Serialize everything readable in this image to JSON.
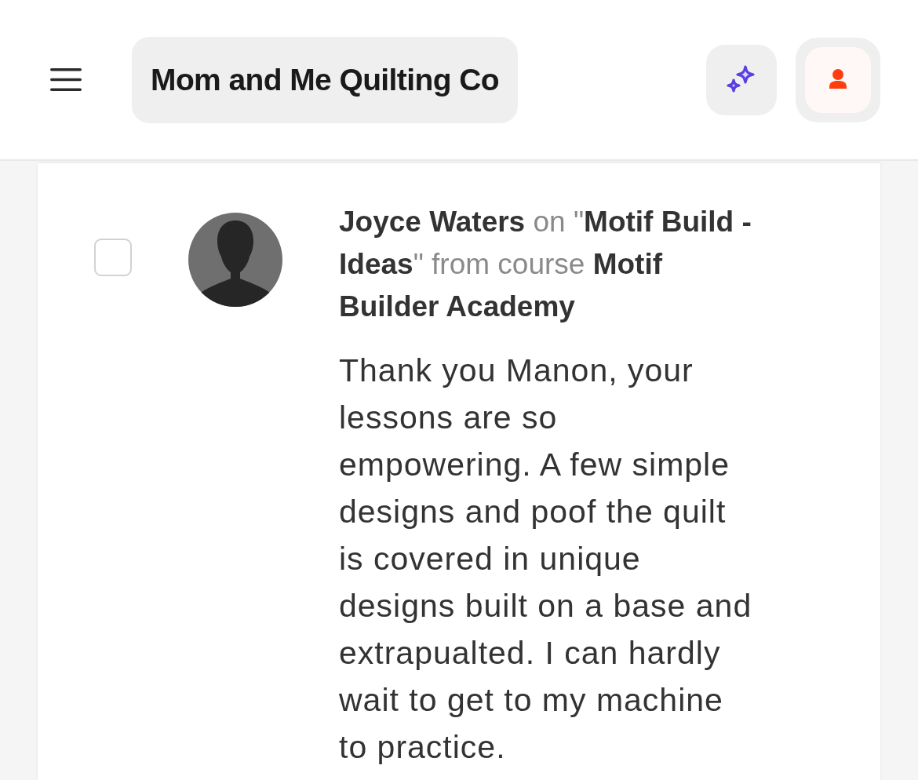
{
  "header": {
    "brand": "Mom and Me Quilting Co"
  },
  "comment": {
    "checked": false,
    "byline": "**Joyce Waters** on \"**Motif Build - Ideas**\" from course **Motif Builder Academy**",
    "text": "Thank you Manon, your lessons are so empowering. A few simple designs and poof the quilt is covered in unique designs built on a base and extrapualted. I can hardly wait to get to my machine to practice."
  }
}
